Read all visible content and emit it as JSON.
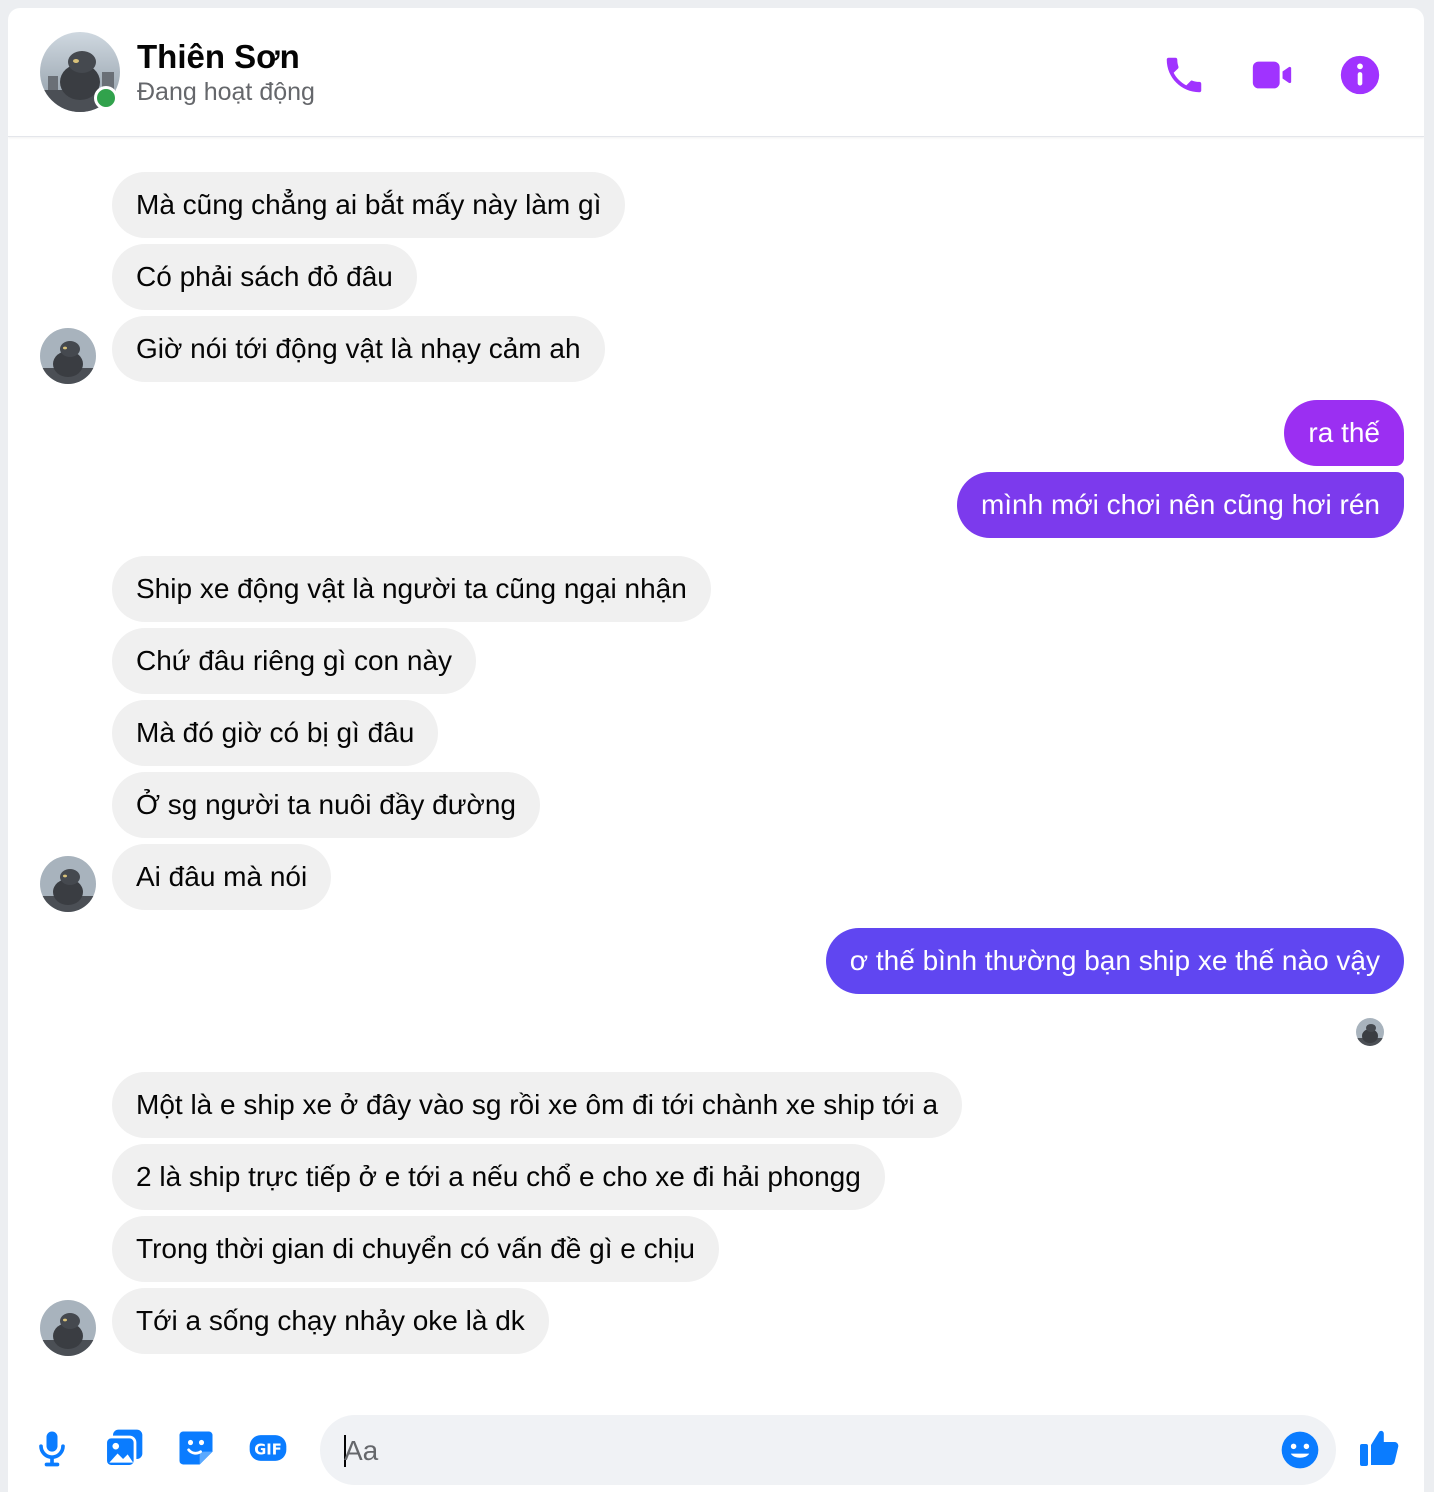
{
  "header": {
    "name": "Thiên Sơn",
    "status": "Đang hoạt động",
    "icons": [
      "phone-icon",
      "video-icon",
      "info-icon"
    ]
  },
  "messages": [
    {
      "dir": "in",
      "text": "Mà cũng chẳng ai bắt mấy này làm gì"
    },
    {
      "dir": "in",
      "text": "Có phải sách đỏ đâu"
    },
    {
      "dir": "in",
      "text": "Giờ nói tới động vật là nhạy cảm ah"
    },
    {
      "dir": "out",
      "text": "ra thế"
    },
    {
      "dir": "out",
      "text": "mình mới chơi nên cũng hơi rén"
    },
    {
      "dir": "in",
      "text": "Ship xe động vật là người ta cũng ngại nhận"
    },
    {
      "dir": "in",
      "text": "Chứ đâu riêng gì con này"
    },
    {
      "dir": "in",
      "text": "Mà đó giờ có bị gì đâu"
    },
    {
      "dir": "in",
      "text": "Ở sg người ta nuôi đầy đường"
    },
    {
      "dir": "in",
      "text": "Ai đâu mà nói"
    },
    {
      "dir": "out",
      "text": "ơ thế bình thường bạn ship xe thế nào vậy"
    },
    {
      "dir": "in",
      "text": "Một là e ship xe ở đây vào sg rồi xe ôm đi tới chành xe ship tới a"
    },
    {
      "dir": "in",
      "text": "2 là ship trực tiếp ở e tới a nếu chổ e cho xe đi hải phongg"
    },
    {
      "dir": "in",
      "text": "Trong thời gian di chuyển có vấn đề gì e chịu"
    },
    {
      "dir": "in",
      "text": "Tới a sống chạy nhảy oke là dk"
    }
  ],
  "composer": {
    "placeholder": "Aa",
    "icons": [
      "microphone-icon",
      "image-icon",
      "sticker-icon",
      "gif-icon",
      "emoji-icon",
      "thumbs-up-icon"
    ]
  },
  "colors": {
    "accent": "#a033ff",
    "bubble_out_top": "#9b2ff2",
    "bubble_out_mid": "#7c3aed",
    "bubble_out_bottom": "#6046f1",
    "bubble_in": "#f0f0f0",
    "composer_blue": "#0a7cff",
    "online": "#31a24c"
  }
}
